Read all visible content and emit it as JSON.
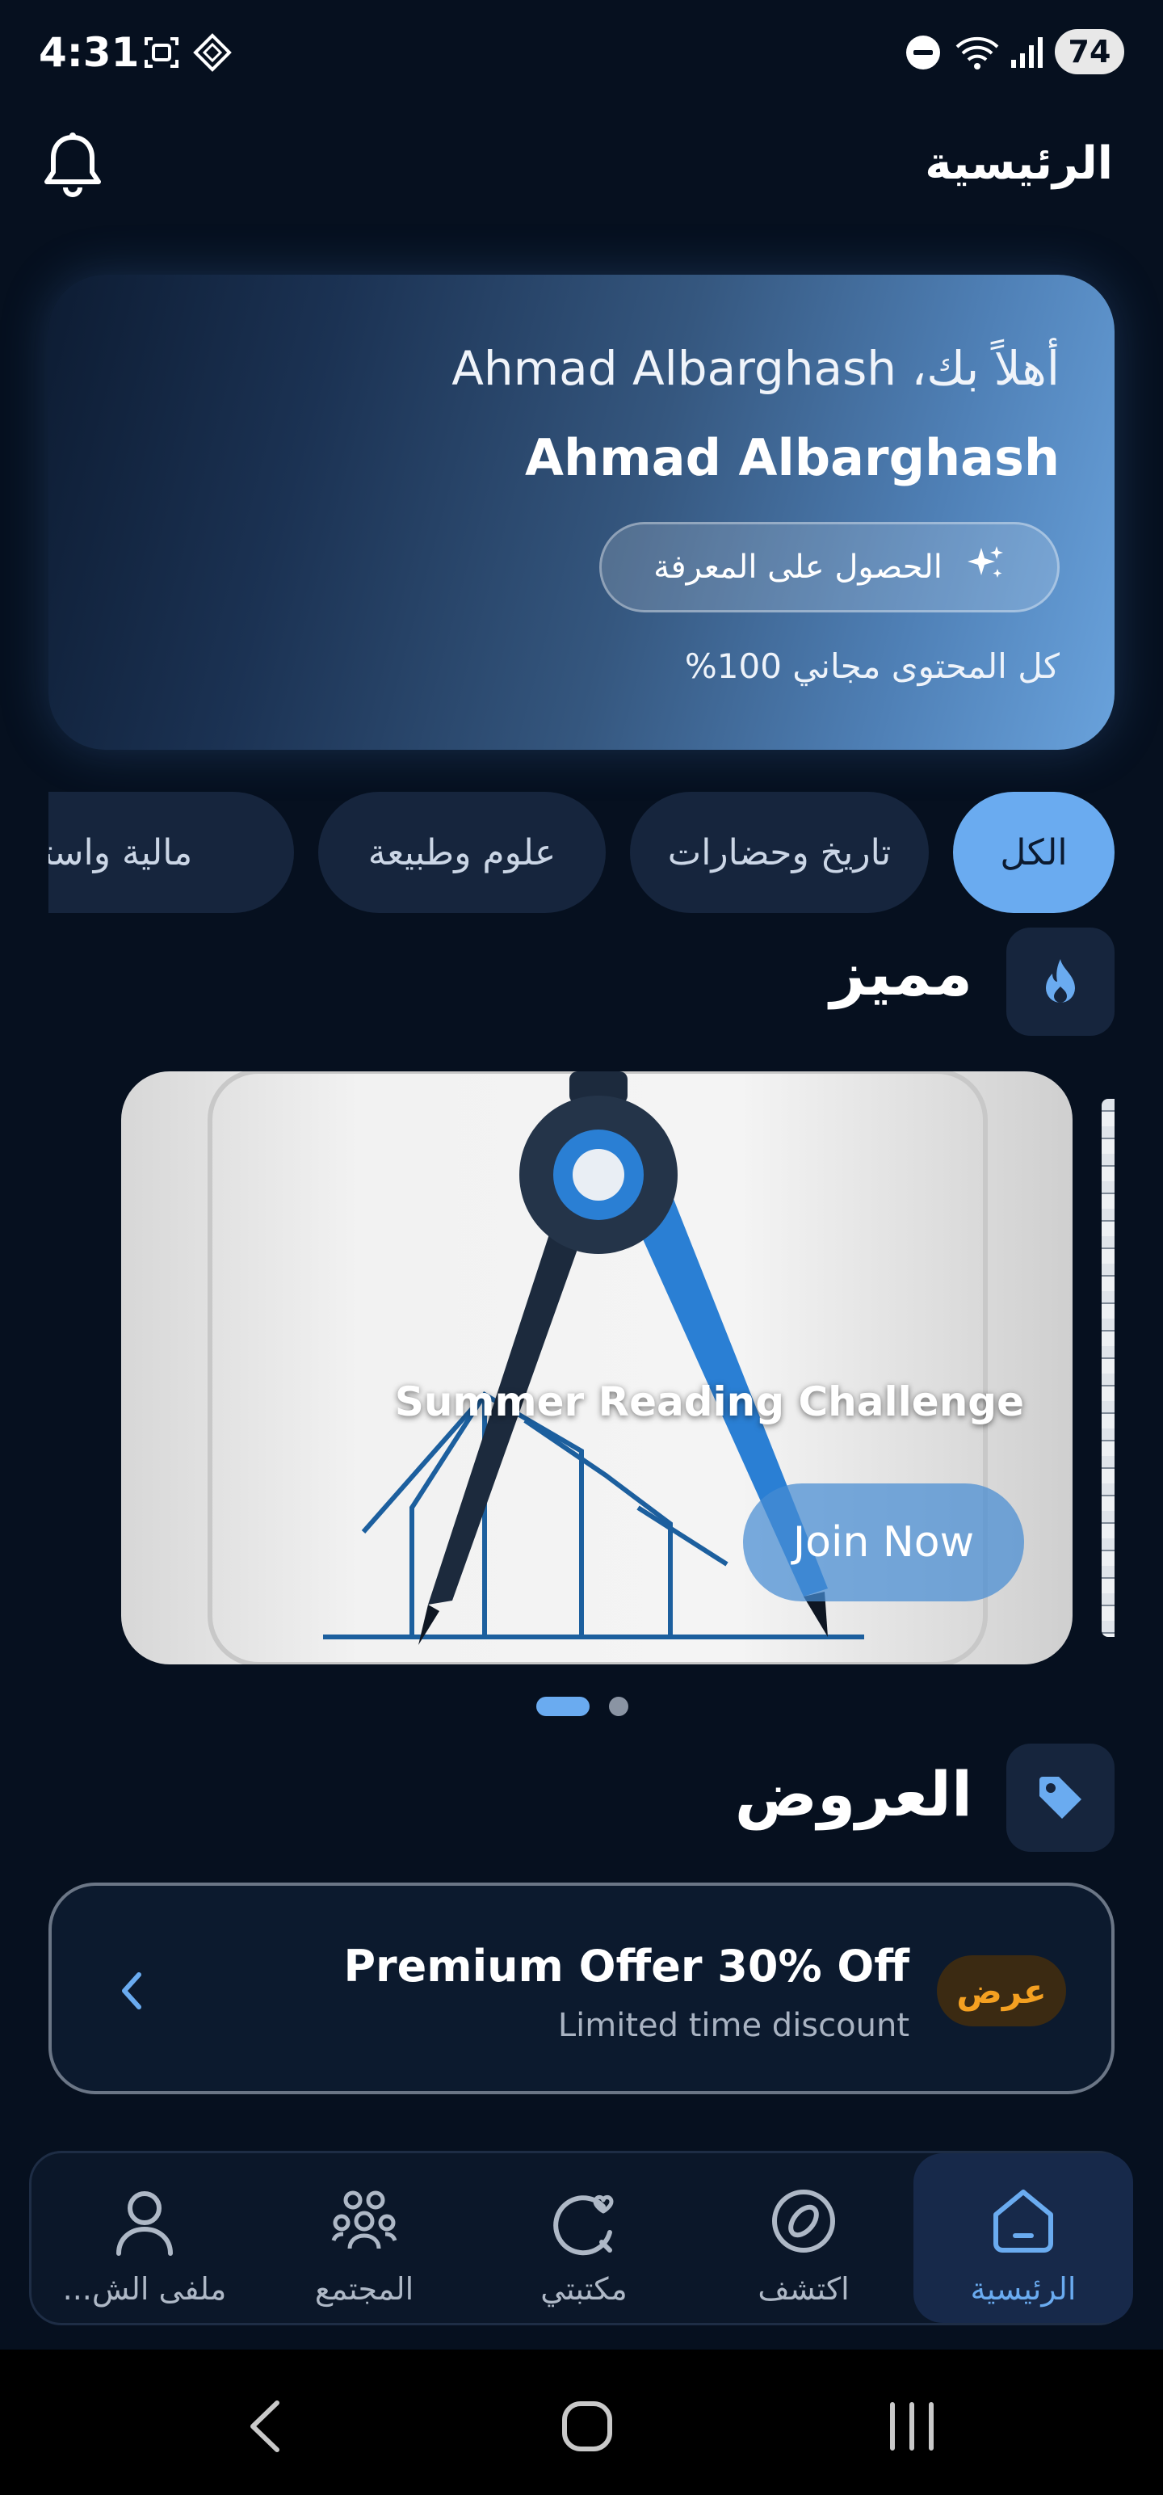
{
  "status_bar": {
    "time": "4:31",
    "battery": "74",
    "icons": [
      "screen-record-icon",
      "diamond-grid-icon",
      "do-not-disturb-icon",
      "wifi-icon",
      "signal-icon"
    ]
  },
  "header": {
    "title": "الرئيسية",
    "bell_icon": "bell-icon"
  },
  "hero": {
    "greeting": "أهلاً بك، Ahmad Albarghash",
    "name": "Ahmad Albarghash",
    "cta_label": "الحصول على المعرفة",
    "cta_icon": "sparkle-icon",
    "note": "كل المحتوى مجاني 100%"
  },
  "categories": {
    "items": [
      {
        "label": "الكل",
        "active": true
      },
      {
        "label": "تاريخ وحضارات",
        "active": false
      },
      {
        "label": "علوم وطبيعة",
        "active": false
      },
      {
        "label": "مالية واستثمار",
        "active": false
      }
    ]
  },
  "featured": {
    "title": "مميز",
    "icon": "flame-icon",
    "banner": {
      "title": "Summer Reading Challenge",
      "button_label": "Join Now"
    },
    "page_count": 2,
    "current_page": 1
  },
  "offers": {
    "title": "العروض",
    "icon": "tag-icon",
    "card": {
      "badge": "عرض",
      "title": "Premium Offer 30% Off",
      "subtitle": "Limited time discount"
    }
  },
  "bottom_nav": {
    "items": [
      {
        "label": "الرئيسية",
        "icon": "home-icon",
        "active": true
      },
      {
        "label": "اكتشف",
        "icon": "compass-icon",
        "active": false
      },
      {
        "label": "مكتبتي",
        "icon": "library-icon",
        "active": false
      },
      {
        "label": "المجتمع",
        "icon": "community-icon",
        "active": false
      },
      {
        "label": "ملفى الش...",
        "icon": "profile-icon",
        "active": false
      }
    ]
  },
  "accent_colors": {
    "primary": "#6aabf0",
    "background": "#06101f",
    "badge_text": "#f4a021"
  }
}
